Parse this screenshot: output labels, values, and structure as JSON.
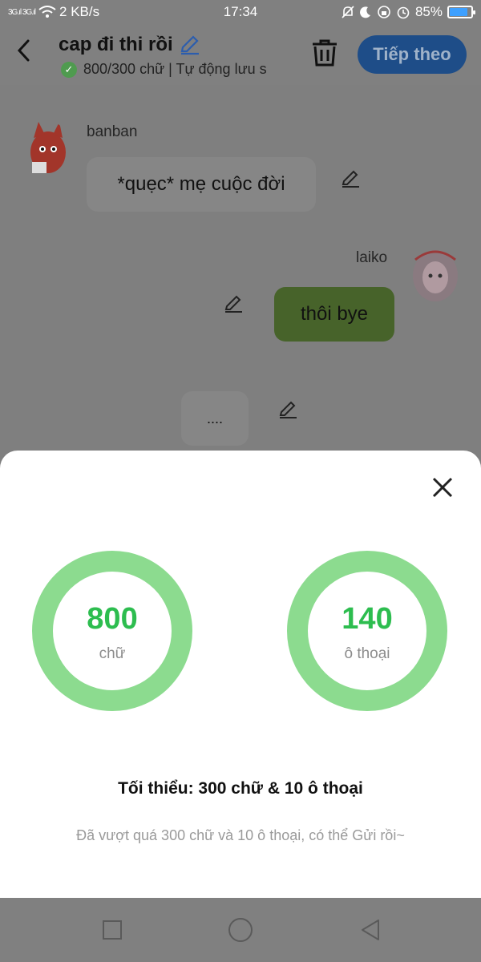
{
  "status_bar": {
    "signal": "3G.ıl 3G.ıl",
    "speed": "2 KB/s",
    "time": "17:34",
    "battery": "85%",
    "battery_level": 0.85,
    "icons": [
      "wifi-icon",
      "mute-icon",
      "moon-icon",
      "lock-rotate-icon",
      "alarm-icon"
    ]
  },
  "header": {
    "title": "cap đi thi rồi",
    "subtitle": "800/300 chữ | Tự động lưu s",
    "next_label": "Tiếp theo"
  },
  "chat": {
    "messages": [
      {
        "sender": "banban",
        "text": "*quẹc* mẹ cuộc đời",
        "side": "left"
      },
      {
        "sender": "laiko",
        "text": "thôi bye",
        "side": "right"
      },
      {
        "sender": "",
        "text": "....",
        "side": "center"
      }
    ]
  },
  "sheet": {
    "stats": [
      {
        "value": "800",
        "label": "chữ"
      },
      {
        "value": "140",
        "label": "ô thoại"
      }
    ],
    "minimum": "Tối thiểu: 300 chữ & 10 ô thoại",
    "note": "Đã vượt quá 300 chữ và 10 ô thoại, có thể Gửi rồi~"
  },
  "colors": {
    "accent_green": "#2dbd4f",
    "ring_green": "#8cdb8f",
    "primary_blue": "#1e4d88",
    "overlay_gray": "#7f7f7f"
  }
}
